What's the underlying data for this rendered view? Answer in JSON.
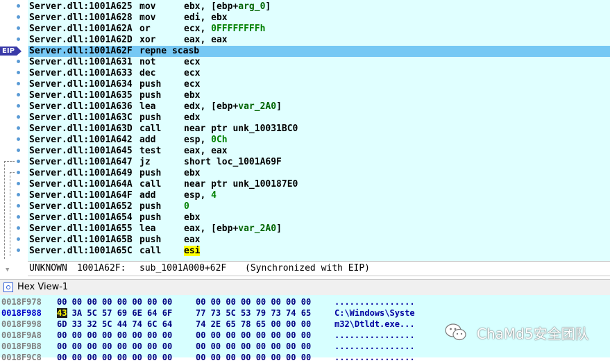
{
  "disasm": {
    "lines": [
      {
        "addr": "Server.dll:1001A625",
        "mnem": "mov",
        "ops": [
          "ebx, [ebp+",
          "arg_0",
          "]"
        ],
        "opsKind": [
          "t",
          "v",
          "t"
        ]
      },
      {
        "addr": "Server.dll:1001A628",
        "mnem": "mov",
        "ops": [
          "edi, ebx"
        ],
        "opsKind": [
          "t"
        ]
      },
      {
        "addr": "Server.dll:1001A62A",
        "mnem": "or",
        "ops": [
          "ecx, ",
          "0FFFFFFFFh"
        ],
        "opsKind": [
          "t",
          "n"
        ]
      },
      {
        "addr": "Server.dll:1001A62D",
        "mnem": "xor",
        "ops": [
          "eax, eax"
        ],
        "opsKind": [
          "t"
        ]
      },
      {
        "addr": "Server.dll:1001A62F",
        "mnem": "repne scasb",
        "ops": [
          ""
        ],
        "opsKind": [
          "t"
        ],
        "current": true
      },
      {
        "addr": "Server.dll:1001A631",
        "mnem": "not",
        "ops": [
          "ecx"
        ],
        "opsKind": [
          "t"
        ]
      },
      {
        "addr": "Server.dll:1001A633",
        "mnem": "dec",
        "ops": [
          "ecx"
        ],
        "opsKind": [
          "t"
        ]
      },
      {
        "addr": "Server.dll:1001A634",
        "mnem": "push",
        "ops": [
          "ecx"
        ],
        "opsKind": [
          "t"
        ]
      },
      {
        "addr": "Server.dll:1001A635",
        "mnem": "push",
        "ops": [
          "ebx"
        ],
        "opsKind": [
          "t"
        ]
      },
      {
        "addr": "Server.dll:1001A636",
        "mnem": "lea",
        "ops": [
          "edx, [ebp+",
          "var_2A0",
          "]"
        ],
        "opsKind": [
          "t",
          "v",
          "t"
        ]
      },
      {
        "addr": "Server.dll:1001A63C",
        "mnem": "push",
        "ops": [
          "edx"
        ],
        "opsKind": [
          "t"
        ]
      },
      {
        "addr": "Server.dll:1001A63D",
        "mnem": "call",
        "ops": [
          "near ptr unk_10031BC0"
        ],
        "opsKind": [
          "t"
        ]
      },
      {
        "addr": "Server.dll:1001A642",
        "mnem": "add",
        "ops": [
          "esp, ",
          "0Ch"
        ],
        "opsKind": [
          "t",
          "n"
        ]
      },
      {
        "addr": "Server.dll:1001A645",
        "mnem": "test",
        "ops": [
          "eax, eax"
        ],
        "opsKind": [
          "t"
        ]
      },
      {
        "addr": "Server.dll:1001A647",
        "mnem": "jz",
        "ops": [
          "short loc_1001A69F"
        ],
        "opsKind": [
          "t"
        ]
      },
      {
        "addr": "Server.dll:1001A649",
        "mnem": "push",
        "ops": [
          "ebx"
        ],
        "opsKind": [
          "t"
        ]
      },
      {
        "addr": "Server.dll:1001A64A",
        "mnem": "call",
        "ops": [
          "near ptr unk_100187E0"
        ],
        "opsKind": [
          "t"
        ]
      },
      {
        "addr": "Server.dll:1001A64F",
        "mnem": "add",
        "ops": [
          "esp, ",
          "4"
        ],
        "opsKind": [
          "t",
          "n"
        ]
      },
      {
        "addr": "Server.dll:1001A652",
        "mnem": "push",
        "ops": [
          "0"
        ],
        "opsKind": [
          "n"
        ]
      },
      {
        "addr": "Server.dll:1001A654",
        "mnem": "push",
        "ops": [
          "ebx"
        ],
        "opsKind": [
          "t"
        ]
      },
      {
        "addr": "Server.dll:1001A655",
        "mnem": "lea",
        "ops": [
          "eax, [ebp+",
          "var_2A0",
          "]"
        ],
        "opsKind": [
          "t",
          "v",
          "t"
        ]
      },
      {
        "addr": "Server.dll:1001A65B",
        "mnem": "push",
        "ops": [
          "eax"
        ],
        "opsKind": [
          "t"
        ]
      },
      {
        "addr": "Server.dll:1001A65C",
        "mnem": "call",
        "ops": [
          "esi"
        ],
        "opsKind": [
          "h"
        ]
      }
    ],
    "eip_label": "EIP",
    "status": {
      "segment": "UNKNOWN",
      "address": "1001A62F:",
      "location": "sub_1001A000+62F",
      "note": "(Synchronized with EIP)"
    }
  },
  "hex_view": {
    "title": "Hex View-1",
    "rows": [
      {
        "addr": "0018F978",
        "bytes1": "00 00 00 00 00 00 00 00",
        "bytes2": "00 00 00 00 00 00 00 00",
        "ascii": "................"
      },
      {
        "addr": "0018F988",
        "bytes1": "43 3A 5C 57 69 6E 64 6F",
        "bytes2": "77 73 5C 53 79 73 74 65",
        "ascii": "C:\\Windows\\Syste",
        "active": true,
        "selected": "43"
      },
      {
        "addr": "0018F998",
        "bytes1": "6D 33 32 5C 44 74 6C 64",
        "bytes2": "74 2E 65 78 65 00 00 00",
        "ascii": "m32\\Dtldt.exe..."
      },
      {
        "addr": "0018F9A8",
        "bytes1": "00 00 00 00 00 00 00 00",
        "bytes2": "00 00 00 00 00 00 00 00",
        "ascii": "................"
      },
      {
        "addr": "0018F9B8",
        "bytes1": "00 00 00 00 00 00 00 00",
        "bytes2": "00 00 00 00 00 00 00 00",
        "ascii": "................"
      },
      {
        "addr": "0018F9C8",
        "bytes1": "00 00 00 00 00 00 00 00",
        "bytes2": "00 00 00 00 00 00 00 00",
        "ascii": "................"
      }
    ]
  },
  "watermark": {
    "text": "ChaMd5安全团队",
    "icon": "wechat-icon"
  }
}
